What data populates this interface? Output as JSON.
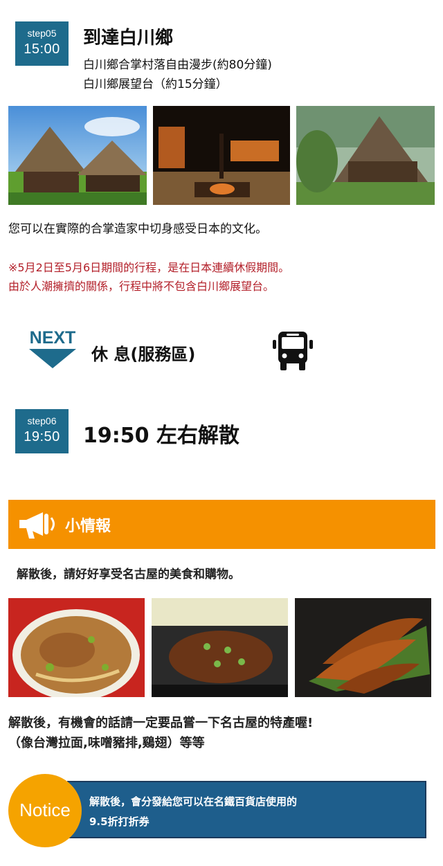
{
  "step05": {
    "label": "step05",
    "time": "15:00",
    "title": "到達白川鄉",
    "details": [
      "白川鄉合掌村落自由漫步(約80分鐘)",
      "白川鄉展望台（約15分鐘）"
    ],
    "photos": [
      "gassho-village-photo",
      "irori-hearth-interior-photo",
      "thatched-house-garden-photo"
    ],
    "description": "您可以在實際的合掌造家中切身感受日本的文化。",
    "notes": [
      "※5月2日至5月6日期間的行程，是在日本連續休假期間。",
      "由於人潮擁擠的關係，行程中將不包含白川鄉展望台。"
    ],
    "note_color": "#b3202a"
  },
  "next": {
    "label": "NEXT",
    "title": "休 息(服務區)",
    "icon": "bus-icon"
  },
  "step06": {
    "label": "step06",
    "time": "19:50",
    "title": "19:50 左右解散"
  },
  "info": {
    "icon": "megaphone-icon",
    "title": "小情報",
    "subtitle": "解散後，請好好享受名古屋的美食和購物。",
    "photos": [
      "taiwan-ramen-photo",
      "miso-katsu-photo",
      "chicken-wings-photo"
    ],
    "food_lines": [
      "解散後，有機會的話請一定要品嘗一下名古屋的特產喔!",
      "（像台灣拉面,味噌豬排,鷄翅）等等"
    ],
    "bar_color": "#f59100"
  },
  "notice": {
    "label": "Notice",
    "lines": [
      "解散後，會分發給您可以在名鐵百貨店使用的",
      "9.5折打折券"
    ],
    "box_color": "#1e5e8c",
    "circle_color": "#f5a300"
  },
  "accent_color": "#1e6b8c"
}
